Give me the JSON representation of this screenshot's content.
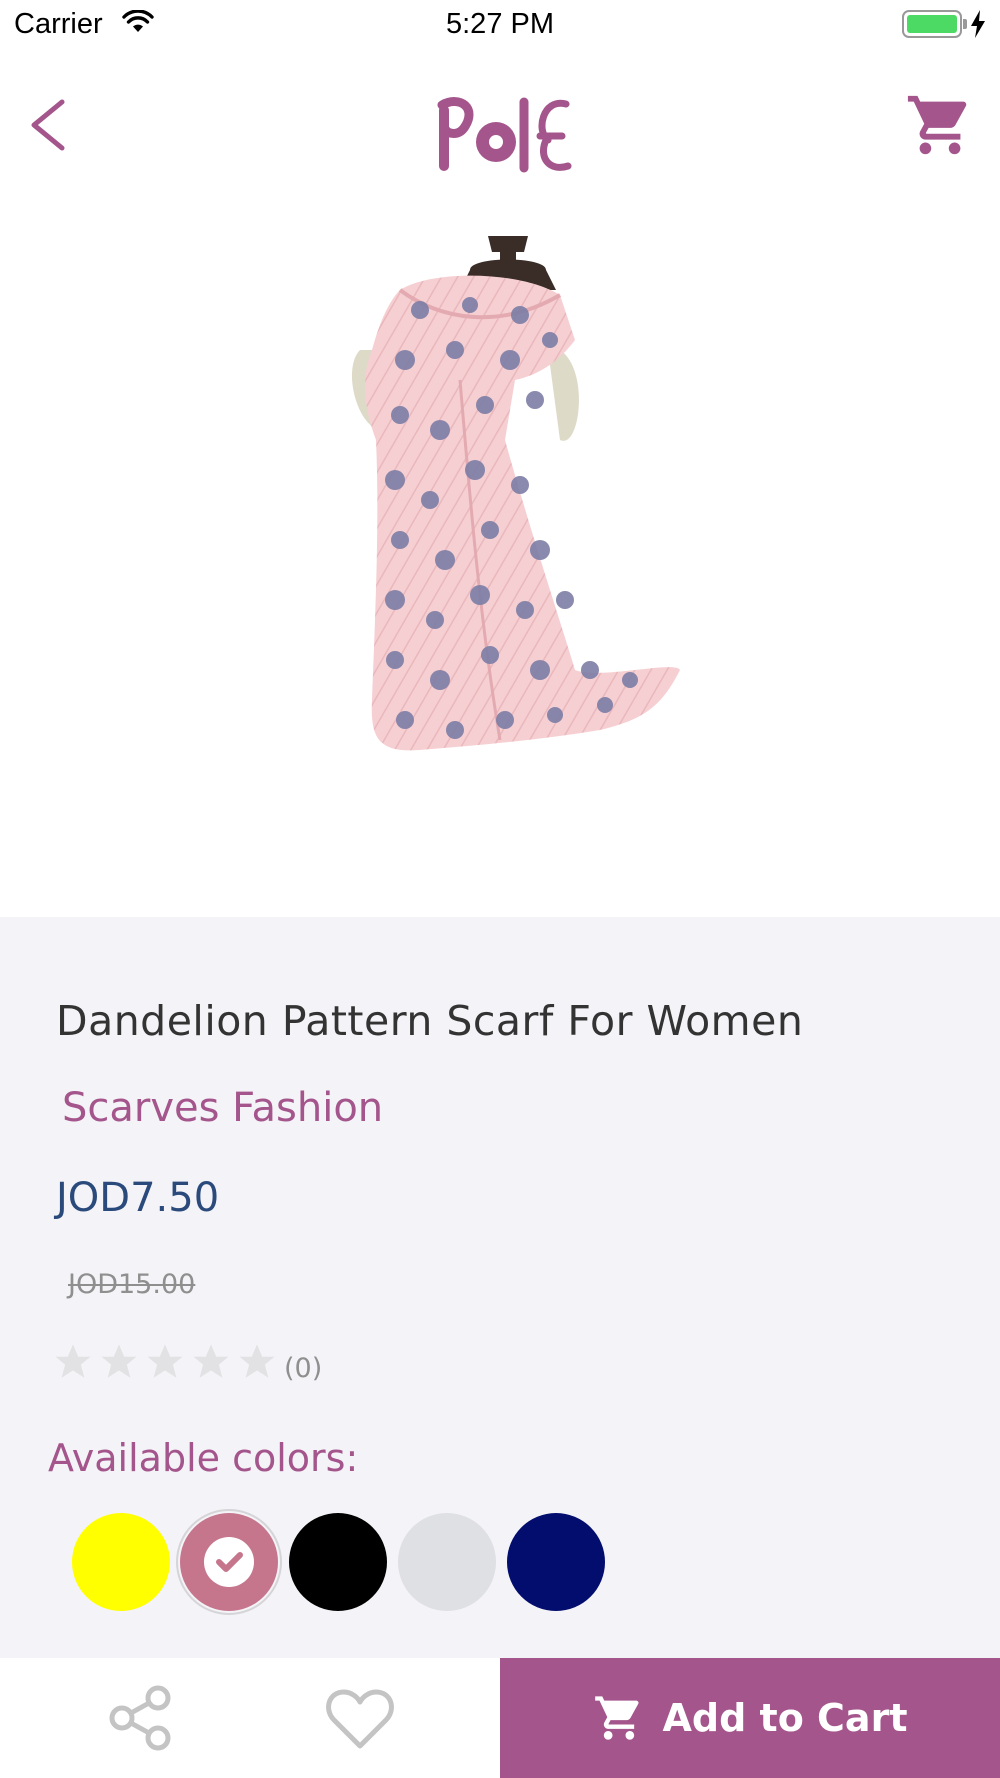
{
  "status_bar": {
    "carrier": "Carrier",
    "time": "5:27 PM"
  },
  "header": {
    "logo_text": "Pole",
    "back_icon": "chevron-left-icon",
    "cart_icon": "cart-icon"
  },
  "product": {
    "name": "Dandelion Pattern Scarf For Women",
    "category": "Scarves Fashion",
    "price": "JOD7.50",
    "old_price": "JOD15.00",
    "rating": 0,
    "rating_max": 5,
    "rating_count": "(0)"
  },
  "colors": {
    "label": "Available colors:",
    "options": [
      {
        "color": "#ffff00",
        "selected": false
      },
      {
        "color": "#c5768c",
        "selected": true
      },
      {
        "color": "#000000",
        "selected": false
      },
      {
        "color": "#dfe0e3",
        "selected": false
      },
      {
        "color": "#020d6e",
        "selected": false
      }
    ]
  },
  "bottom_bar": {
    "share_icon": "share-icon",
    "favorite_icon": "heart-icon",
    "add_to_cart_label": "Add to Cart"
  },
  "theme": {
    "accent": "#a4558c",
    "price_color": "#2b4a7c",
    "background": "#f4f3f7"
  }
}
